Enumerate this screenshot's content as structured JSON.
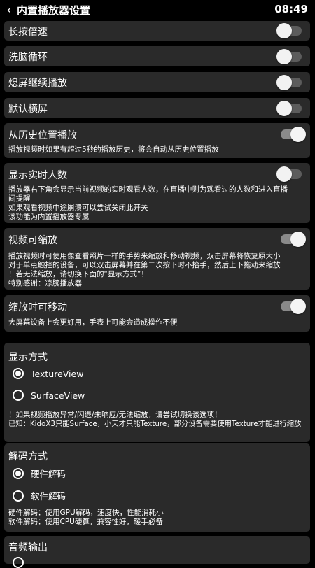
{
  "header": {
    "back_icon": "‹",
    "title": "内置播放器设置",
    "time": "08:49"
  },
  "toggles": [
    {
      "label": "长按倍速",
      "state": "off"
    },
    {
      "label": "洗脑循环",
      "state": "off"
    },
    {
      "label": "熄屏继续播放",
      "state": "off"
    },
    {
      "label": "默认横屏",
      "state": "off"
    },
    {
      "label": "从历史位置播放",
      "state": "on",
      "desc": [
        "播放视频时如果有超过5秒的播放历史，将会自动从历史位置播放"
      ]
    },
    {
      "label": "显示实时人数",
      "state": "off",
      "desc": [
        "播放器右下角会显示当前视频的实时观看人数，在直播中则为观看过的人数和进入直播",
        "间提醒",
        "如果观看视频中途崩溃可以尝试关闭此开关",
        "该功能为内置播放器专属"
      ]
    },
    {
      "label": "视频可缩放",
      "state": "on",
      "desc": [
        "播放视频时可使用像查看照片一样的手势来缩放和移动视频，双击屏幕将恢复原大小",
        "对于单点触控的设备，可以双击屏幕并在第二次按下时不抬手，然后上下拖动来缩放",
        "！若无法缩放，请切换下面的“显示方式”！",
        "特别感谢：凉腕播放器"
      ]
    },
    {
      "label": "缩放时可移动",
      "state": "on",
      "desc": [
        "大屏幕设备上会更好用，手表上可能会造成操作不便"
      ]
    }
  ],
  "display_mode": {
    "title": "显示方式",
    "options": [
      {
        "label": "TextureView",
        "selected": true
      },
      {
        "label": "SurfaceView",
        "selected": false
      }
    ],
    "desc": [
      "！如果视频播放异常/闪退/未响应/无法缩放，请尝试切换该选项！",
      "已知：KidoX3只能Surface，小天才只能Texture，部分设备需要使用Texture才能进行缩放"
    ]
  },
  "decode_mode": {
    "title": "解码方式",
    "options": [
      {
        "label": "硬件解码",
        "selected": true
      },
      {
        "label": "软件解码",
        "selected": false
      }
    ],
    "desc": [
      "硬件解码：使用GPU解码，速度快，性能消耗小",
      "软件解码：使用CPU硬算，兼容性好，暖手必备"
    ]
  },
  "audio_output": {
    "title": "音频输出"
  }
}
